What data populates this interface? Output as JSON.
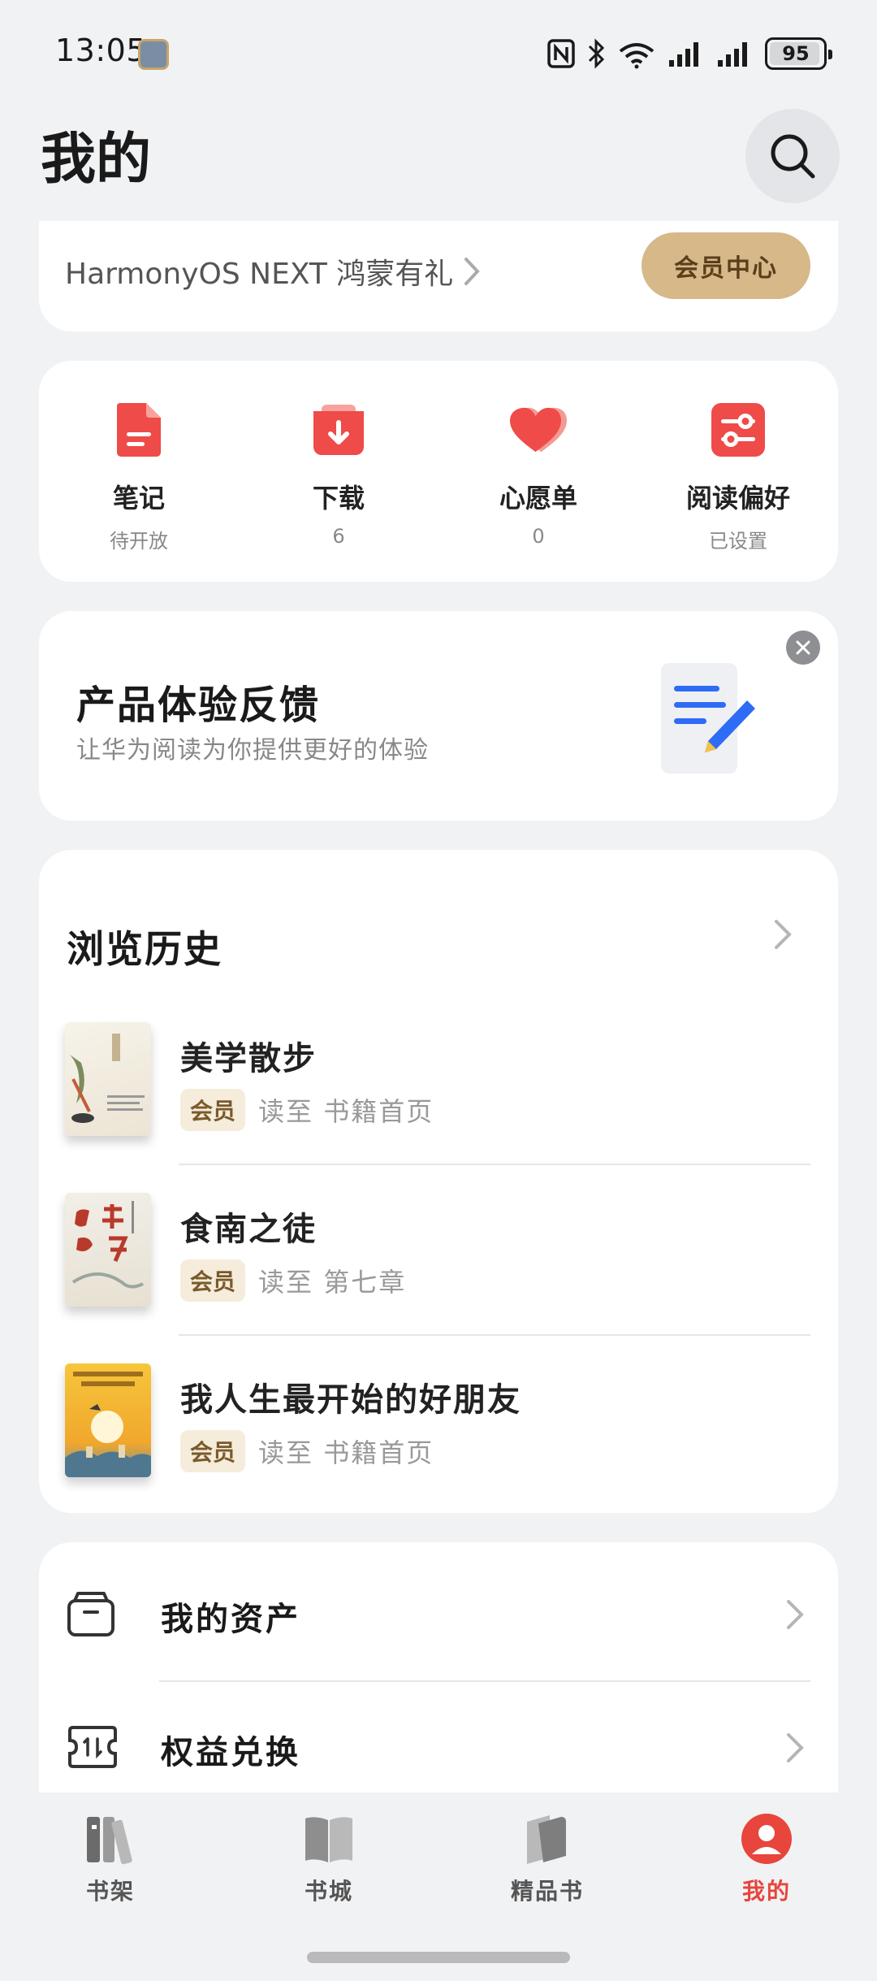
{
  "status": {
    "time": "13:05",
    "battery": "95",
    "battery_level": 0.95
  },
  "header": {
    "title": "我的"
  },
  "vip": {
    "promo": "HarmonyOS NEXT 鸿蒙有礼",
    "button": "会员中心"
  },
  "quick": {
    "items": [
      {
        "label": "笔记",
        "sub": "待开放",
        "icon": "note-icon"
      },
      {
        "label": "下载",
        "sub": "6",
        "icon": "download-icon"
      },
      {
        "label": "心愿单",
        "sub": "0",
        "icon": "heart-icon"
      },
      {
        "label": "阅读偏好",
        "sub": "已设置",
        "icon": "preference-icon"
      }
    ]
  },
  "feedback": {
    "title": "产品体验反馈",
    "subtitle": "让华为阅读为你提供更好的体验"
  },
  "history": {
    "title": "浏览历史",
    "books": [
      {
        "title": "美学散步",
        "badge": "会员",
        "progress": "读至 书籍首页"
      },
      {
        "title": "食南之徒",
        "badge": "会员",
        "progress": "读至 第七章"
      },
      {
        "title": "我人生最开始的好朋友",
        "badge": "会员",
        "progress": "读至 书籍首页"
      }
    ]
  },
  "menu": {
    "items": [
      {
        "label": "我的资产",
        "icon": "wallet-icon"
      },
      {
        "label": "权益兑换",
        "icon": "ticket-icon"
      }
    ]
  },
  "tabs": [
    {
      "label": "书架",
      "icon": "bookshelf-icon"
    },
    {
      "label": "书城",
      "icon": "bookstore-icon"
    },
    {
      "label": "精品书",
      "icon": "premium-book-icon"
    },
    {
      "label": "我的",
      "icon": "profile-icon"
    }
  ],
  "colors": {
    "accent": "#e8453c",
    "vip_gold": "#d6b889",
    "background": "#f1f2f4"
  }
}
